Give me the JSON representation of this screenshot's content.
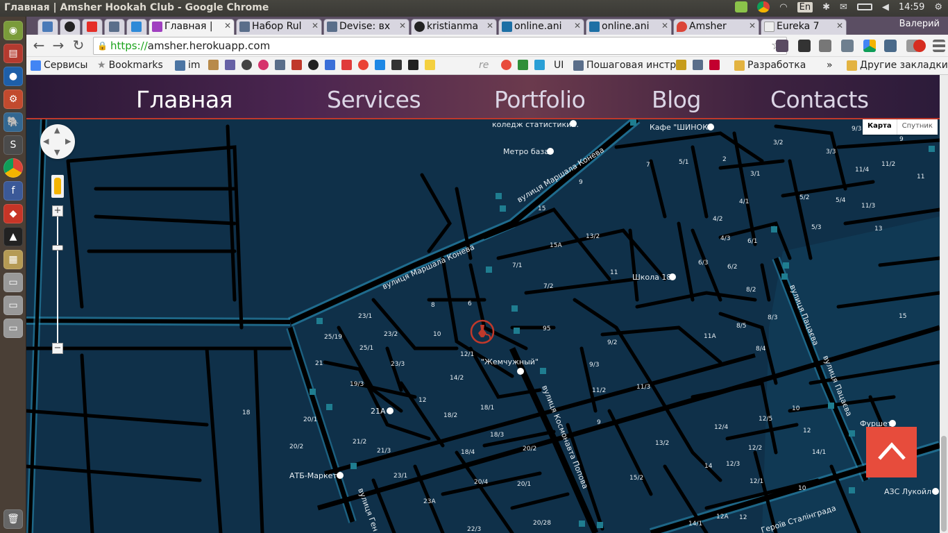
{
  "os": {
    "window_title": "Главная | Amsher Hookah Club - Google Chrome",
    "keyboard_layout": "En",
    "clock": "14:59"
  },
  "browser": {
    "user_name": "Валерий",
    "tabs": [
      {
        "label": "Главная |",
        "active": true
      },
      {
        "label": "Набор Rul",
        "active": false
      },
      {
        "label": "Devise: вх",
        "active": false
      },
      {
        "label": "kristianma",
        "active": false
      },
      {
        "label": "online.ani",
        "active": false
      },
      {
        "label": "online.ani",
        "active": false
      },
      {
        "label": "Amsher",
        "active": false
      },
      {
        "label": "Eureka 7",
        "active": false
      }
    ],
    "url_scheme": "https://",
    "url_host": "amsher.herokuapp.com",
    "bookmarks": {
      "services": "Сервисы",
      "bookmarks": "Bookmarks",
      "im": "im",
      "re": "re",
      "ui": "UI",
      "guide": "Пошаговая инстр",
      "development": "Разработка",
      "more": "»",
      "other": "Другие закладки"
    }
  },
  "site": {
    "nav": [
      {
        "label": "Главная",
        "active": true
      },
      {
        "label": "Services",
        "active": false
      },
      {
        "label": "Portfolio",
        "active": false
      },
      {
        "label": "Blog",
        "active": false
      },
      {
        "label": "Contacts",
        "active": false
      }
    ],
    "map": {
      "type_map": "Карта",
      "type_satellite": "Спутник",
      "zoom_in": "+",
      "zoom_out": "−",
      "colors": {
        "background": "#0f3049",
        "roads": "#000000",
        "highlight": "#2d9cc4",
        "marker": "#c0392b"
      },
      "streets": {
        "konev1": "вулиця Маршала Конева",
        "konev2": "вулиця Маршала Конева",
        "popov": "вулиця Космонавта Попова",
        "patsaeva1": "вулиця Пацаєва",
        "patsaeva2": "вулиця Пацаєва",
        "stalingrad": "Героїв Сталінграда",
        "gen": "вулиця Ген"
      },
      "places": {
        "college": "коледж статистики...",
        "cafe": "Кафе \"ШИНОК\"",
        "metro_baza": "Метро база",
        "school": "Школа 18",
        "zhemchuzhny": "\"Жемчужный\"",
        "atb": "АТБ-Маркет",
        "furshet": "Фуршет",
        "azs": "АЗС Лукойл"
      },
      "house_numbers": {
        "h9_3": "9/3",
        "h9": "9",
        "h3_2": "3/2",
        "h3_3": "3/3",
        "h11_4": "11/4",
        "h11_2": "11/2",
        "h11": "11",
        "h7": "7",
        "h5_1": "5/1",
        "h2": "2",
        "h3_1": "3/1",
        "h9b": "9",
        "h4_1": "4/1",
        "h5_2": "5/2",
        "h5_4": "5/4",
        "h11_3": "11/3",
        "h15": "15",
        "h4_2": "4/2",
        "h5_3": "5/3",
        "h13": "13",
        "h15a": "15А",
        "h13_2": "13/2",
        "h4_3": "4/3",
        "h6_1": "6/1",
        "h7_1": "7/1",
        "h6_3": "6/3",
        "h6_2": "6/2",
        "h11b": "11",
        "h7_2": "7/2",
        "h8_2": "8/2",
        "h8": "8",
        "h6": "6",
        "h8_3": "8/3",
        "h15b": "15",
        "h23_1": "23/1",
        "h95": "95",
        "h8_5": "8/5",
        "h25_19": "25/19",
        "h23_2": "23/2",
        "h10": "10",
        "h9_2": "9/2",
        "h11a": "11А",
        "h8_4": "8/4",
        "h25_1": "25/1",
        "h12_1": "12/1",
        "h21": "21",
        "h23_3": "23/3",
        "h9_3b": "9/3",
        "h14_2": "14/2",
        "h19_3": "19/3",
        "h11_2b": "11/2",
        "h11_3b": "11/3",
        "h12": "12",
        "h18_1": "18/1",
        "h18": "18",
        "h21a": "21А",
        "h18_2": "18/2",
        "h20_1": "20/1",
        "h9c": "9",
        "h10b": "10",
        "h12_5": "12/5",
        "h12_4": "12/4",
        "h12b": "12",
        "h18_3": "18/3",
        "h20_2": "20/2",
        "h21_2": "21/2",
        "h13_2b": "13/2",
        "h12_2": "12/2",
        "h14_1": "14/1",
        "h21_3": "21/3",
        "h18_4": "18/4",
        "h20_2b": "20/2",
        "h14": "14",
        "h12_3": "12/3",
        "h23_1b": "23/1",
        "h20_4": "20/4",
        "h20_1b": "20/1",
        "h15_2": "15/2",
        "h12_1b": "12/1",
        "h10c": "10",
        "h23a": "23А",
        "h12a": "12А",
        "h12c": "12",
        "h20_28": "20/28",
        "h14_1b": "14/1",
        "h22_3": "22/3"
      }
    }
  }
}
